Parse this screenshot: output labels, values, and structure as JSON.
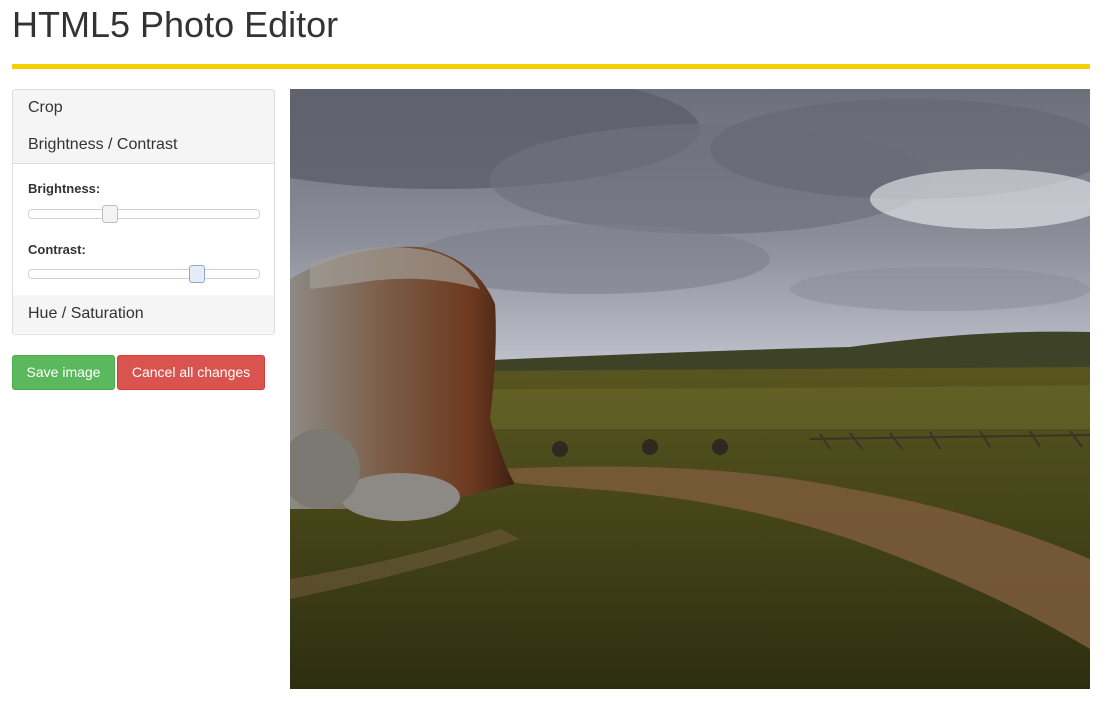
{
  "header": {
    "title": "HTML5 Photo Editor",
    "accent_color": "#f5d000"
  },
  "sidebar": {
    "sections": [
      {
        "label": "Crop"
      },
      {
        "label": "Brightness / Contrast"
      },
      {
        "label": "Hue / Saturation"
      }
    ],
    "brightness": {
      "label": "Brightness:",
      "value": 0.35
    },
    "contrast": {
      "label": "Contrast:",
      "value": 0.73
    }
  },
  "actions": {
    "save_label": "Save image",
    "cancel_label": "Cancel all changes",
    "save_color": "#5cb85c",
    "cancel_color": "#d9534f"
  },
  "photo": {
    "subject": "landscape-photo"
  }
}
